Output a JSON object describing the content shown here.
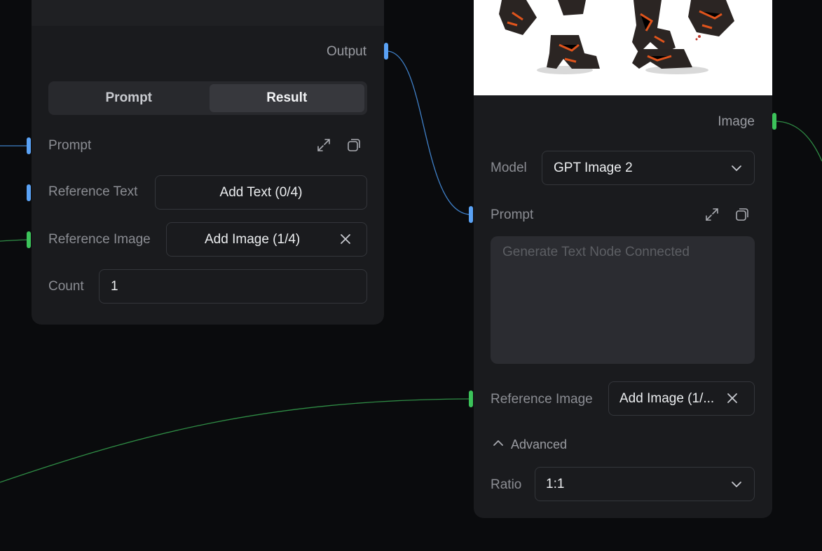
{
  "left_node": {
    "output_label": "Output",
    "tabs": [
      {
        "label": "Prompt",
        "active": false
      },
      {
        "label": "Result",
        "active": true
      }
    ],
    "prompt_label": "Prompt",
    "reference_text_label": "Reference Text",
    "reference_text_button": "Add Text (0/4)",
    "reference_image_label": "Reference Image",
    "reference_image_button": "Add Image (1/4)",
    "count_label": "Count",
    "count_value": "1"
  },
  "right_node": {
    "image_output_label": "Image",
    "model_label": "Model",
    "model_value": "GPT Image 2",
    "prompt_label": "Prompt",
    "prompt_placeholder": "Generate Text Node Connected",
    "reference_image_label": "Reference Image",
    "reference_image_button": "Add Image (1/...",
    "advanced_label": "Advanced",
    "ratio_label": "Ratio",
    "ratio_value": "1:1"
  },
  "icons": {
    "expand": "expand-icon",
    "copy": "copy-icon",
    "close": "close-icon",
    "chevron_down": "chevron-down-icon",
    "chevron_up": "chevron-up-icon"
  },
  "colors": {
    "canvas": "#0a0b0d",
    "node_bg": "#1a1b1e",
    "port_blue": "#5aa2f5",
    "port_green": "#3cc35a"
  }
}
